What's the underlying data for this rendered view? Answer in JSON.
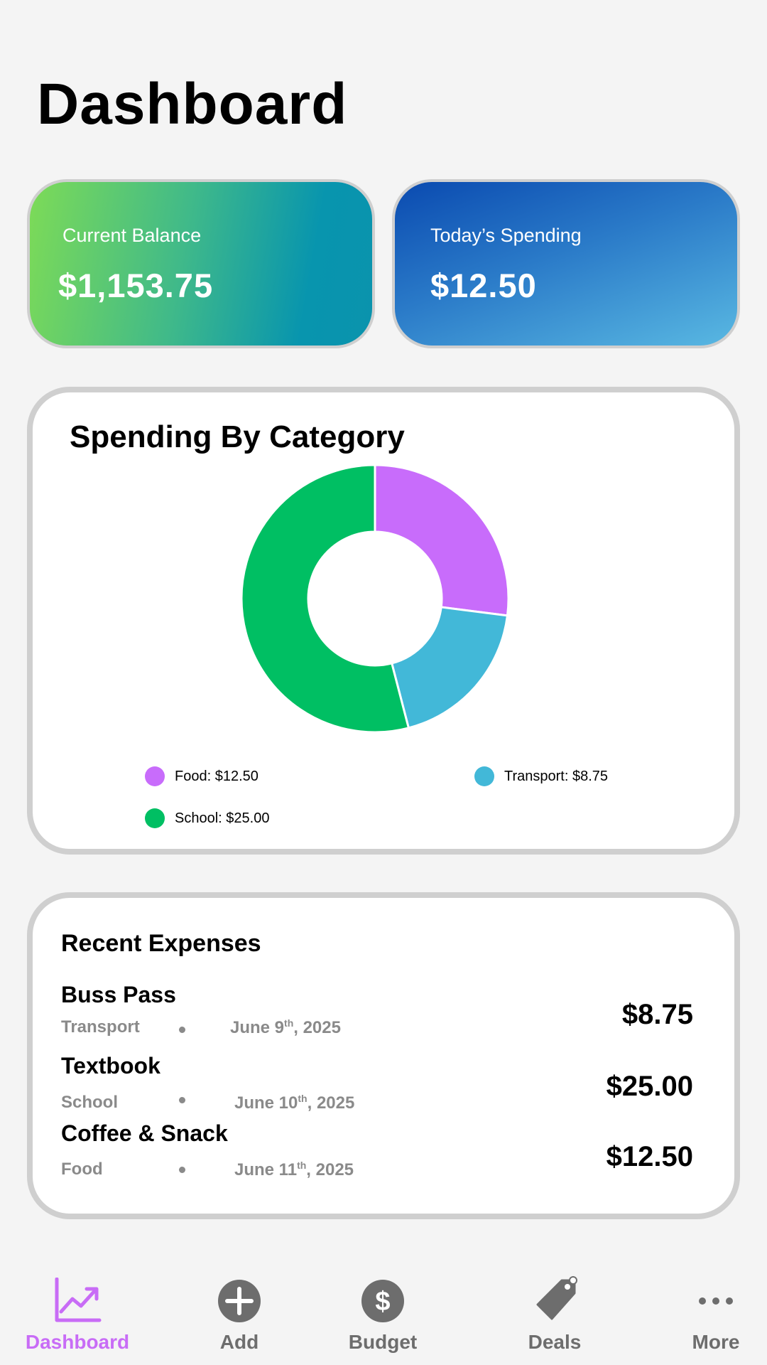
{
  "header": {
    "title": "Dashboard"
  },
  "cards": {
    "balance": {
      "label": "Current Balance",
      "value": "$1,153.75"
    },
    "spending": {
      "label": "Today’s Spending",
      "value": "$12.50"
    }
  },
  "category_chart": {
    "title": "Spending By Category",
    "legend": [
      {
        "label": "Food: $12.50",
        "color": "#c86cfb"
      },
      {
        "label": "Transport: $8.75",
        "color": "#42b8d8"
      },
      {
        "label": "School: $25.00",
        "color": "#00bf63"
      }
    ]
  },
  "chart_data": {
    "type": "pie",
    "categories": [
      "Food",
      "Transport",
      "School"
    ],
    "values": [
      12.5,
      8.75,
      25.0
    ],
    "colors": [
      "#c86cfb",
      "#42b8d8",
      "#00bf63"
    ],
    "donut": true,
    "title": "Spending By Category",
    "legend_position": "bottom"
  },
  "expenses": {
    "title": "Recent Expenses",
    "items": [
      {
        "name": "Buss Pass",
        "category": "Transport",
        "date_day": "June 9",
        "date_suffix": "th",
        "date_year": ", 2025",
        "amount": "$8.75"
      },
      {
        "name": "Textbook",
        "category": "School",
        "date_day": "June 10",
        "date_suffix": "th",
        "date_year": ", 2025",
        "amount": "$25.00"
      },
      {
        "name": "Coffee & Snack",
        "category": "Food",
        "date_day": "June 11",
        "date_suffix": "th",
        "date_year": ", 2025",
        "amount": "$12.50"
      }
    ]
  },
  "nav": {
    "accent": "#c86cf6",
    "inactive_color": "#6d6d6d",
    "items": [
      {
        "label": "Dashboard",
        "icon": "chart-trend-icon",
        "active": true
      },
      {
        "label": "Add",
        "icon": "plus-circle-icon",
        "active": false
      },
      {
        "label": "Budget",
        "icon": "dollar-circle-icon",
        "active": false
      },
      {
        "label": "Deals",
        "icon": "tag-icon",
        "active": false
      },
      {
        "label": "More",
        "icon": "ellipsis-icon",
        "active": false
      }
    ]
  }
}
